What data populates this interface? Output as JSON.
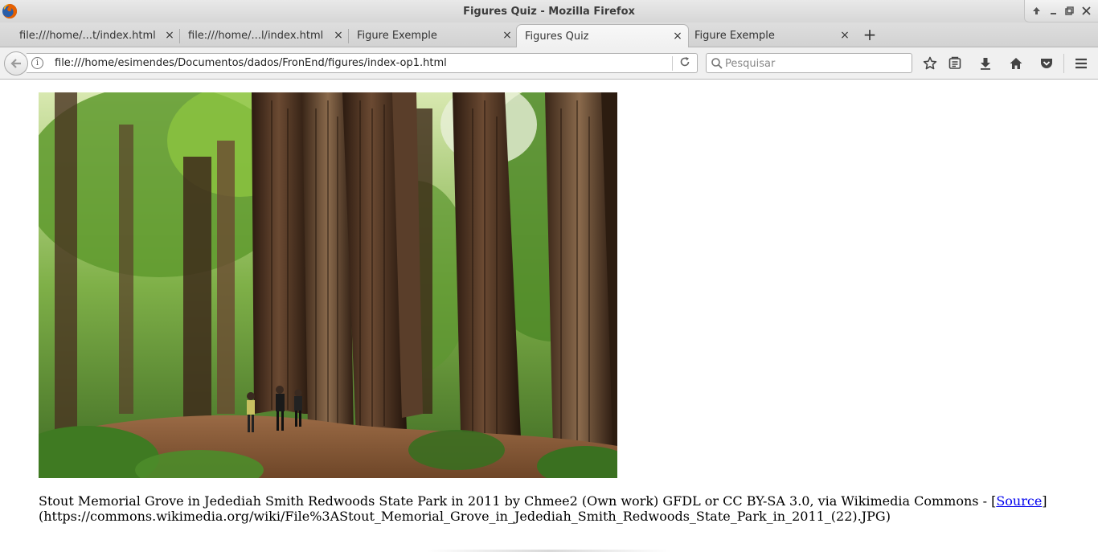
{
  "window": {
    "title": "Figures Quiz - Mozilla Firefox",
    "controls": [
      "up-icon",
      "minimize-icon",
      "restore-icon",
      "close-icon"
    ]
  },
  "tabs": [
    {
      "label": "file:///home/...t/index.html",
      "active": false
    },
    {
      "label": "file:///home/...l/index.html",
      "active": false
    },
    {
      "label": "Figure Exemple",
      "active": false
    },
    {
      "label": "Figures Quiz",
      "active": true
    },
    {
      "label": "Figure Exemple",
      "active": false
    }
  ],
  "new_tab": "+",
  "navbar": {
    "url": "file:///home/esimendes/Documentos/dados/FronEnd/figures/index-op1.html",
    "search_placeholder": "Pesquisar",
    "toolbar_icons": [
      "bookmark-star-icon",
      "reading-list-icon",
      "download-icon",
      "home-icon",
      "pocket-icon",
      "hamburger-menu-icon"
    ]
  },
  "page": {
    "caption_text": "Stout Memorial Grove in Jedediah Smith Redwoods State Park in 2011 by Chmee2 (Own work) GFDL or CC BY-SA 3.0, via Wikimedia Commons - [",
    "source_link": "Source",
    "caption_after": "]",
    "caption_url": "(https://commons.wikimedia.org/wiki/File%3AStout_Memorial_Grove_in_Jedediah_Smith_Redwoods_State_Park_in_2011_(22).JPG)"
  },
  "colors": {
    "link": "#0000ee",
    "forest_dark": "#2a1d12",
    "foliage": "#6aa83a"
  }
}
